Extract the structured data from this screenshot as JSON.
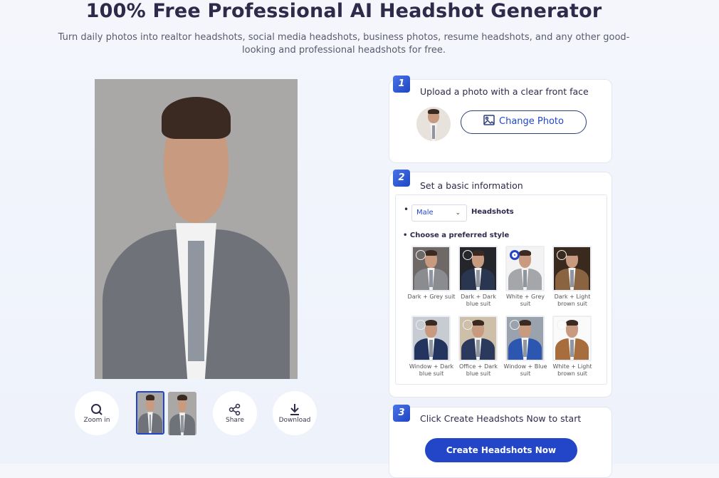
{
  "header": {
    "title": "100% Free Professional AI Headshot Generator",
    "subtitle": "Turn daily photos into realtor headshots, social media headshots, business photos, resume headshots, and any other good-looking and professional headshots for free."
  },
  "preview": {
    "bg": "#a9a8a6",
    "suit": "#6f7379",
    "actions": {
      "zoom": "Zoom in",
      "share": "Share",
      "download": "Download"
    },
    "thumbnails": [
      {
        "selected": true
      },
      {
        "selected": false
      }
    ]
  },
  "step1": {
    "number": "1",
    "title": "Upload a photo with a clear front face",
    "button": "Change Photo"
  },
  "step2": {
    "number": "2",
    "title": "Set a basic information",
    "gender": "Male",
    "gender_suffix": "Headshots",
    "style_heading": "Choose a preferred style",
    "styles": [
      {
        "label": "Dark + Grey suit",
        "bg": "#6e6866",
        "suit": "#8a8c90",
        "selected": false
      },
      {
        "label": "Dark + Dark blue suit",
        "bg": "#24262c",
        "suit": "#2a3550",
        "selected": false
      },
      {
        "label": "White + Grey suit",
        "bg": "#f3f3f3",
        "suit": "#a4a6aa",
        "selected": true
      },
      {
        "label": "Dark + Light brown suit",
        "bg": "#3a2a1e",
        "suit": "#8a6440",
        "selected": false
      },
      {
        "label": "Window + Dark blue suit",
        "bg": "#c7ccd2",
        "suit": "#23345e",
        "selected": false
      },
      {
        "label": "Office + Dark blue suit",
        "bg": "#cdbfa8",
        "suit": "#2b3a5c",
        "selected": false
      },
      {
        "label": "Window + Blue suit",
        "bg": "#9aa3ad",
        "suit": "#2c56b0",
        "selected": false
      },
      {
        "label": "White + Light brown suit",
        "bg": "#fafafa",
        "suit": "#a86d3c",
        "selected": false
      }
    ]
  },
  "step3": {
    "number": "3",
    "title": "Click Create Headshots Now to start",
    "button": "Create Headshots Now"
  },
  "colors": {
    "accent": "#2346c8",
    "text": "#2d2a4a"
  }
}
